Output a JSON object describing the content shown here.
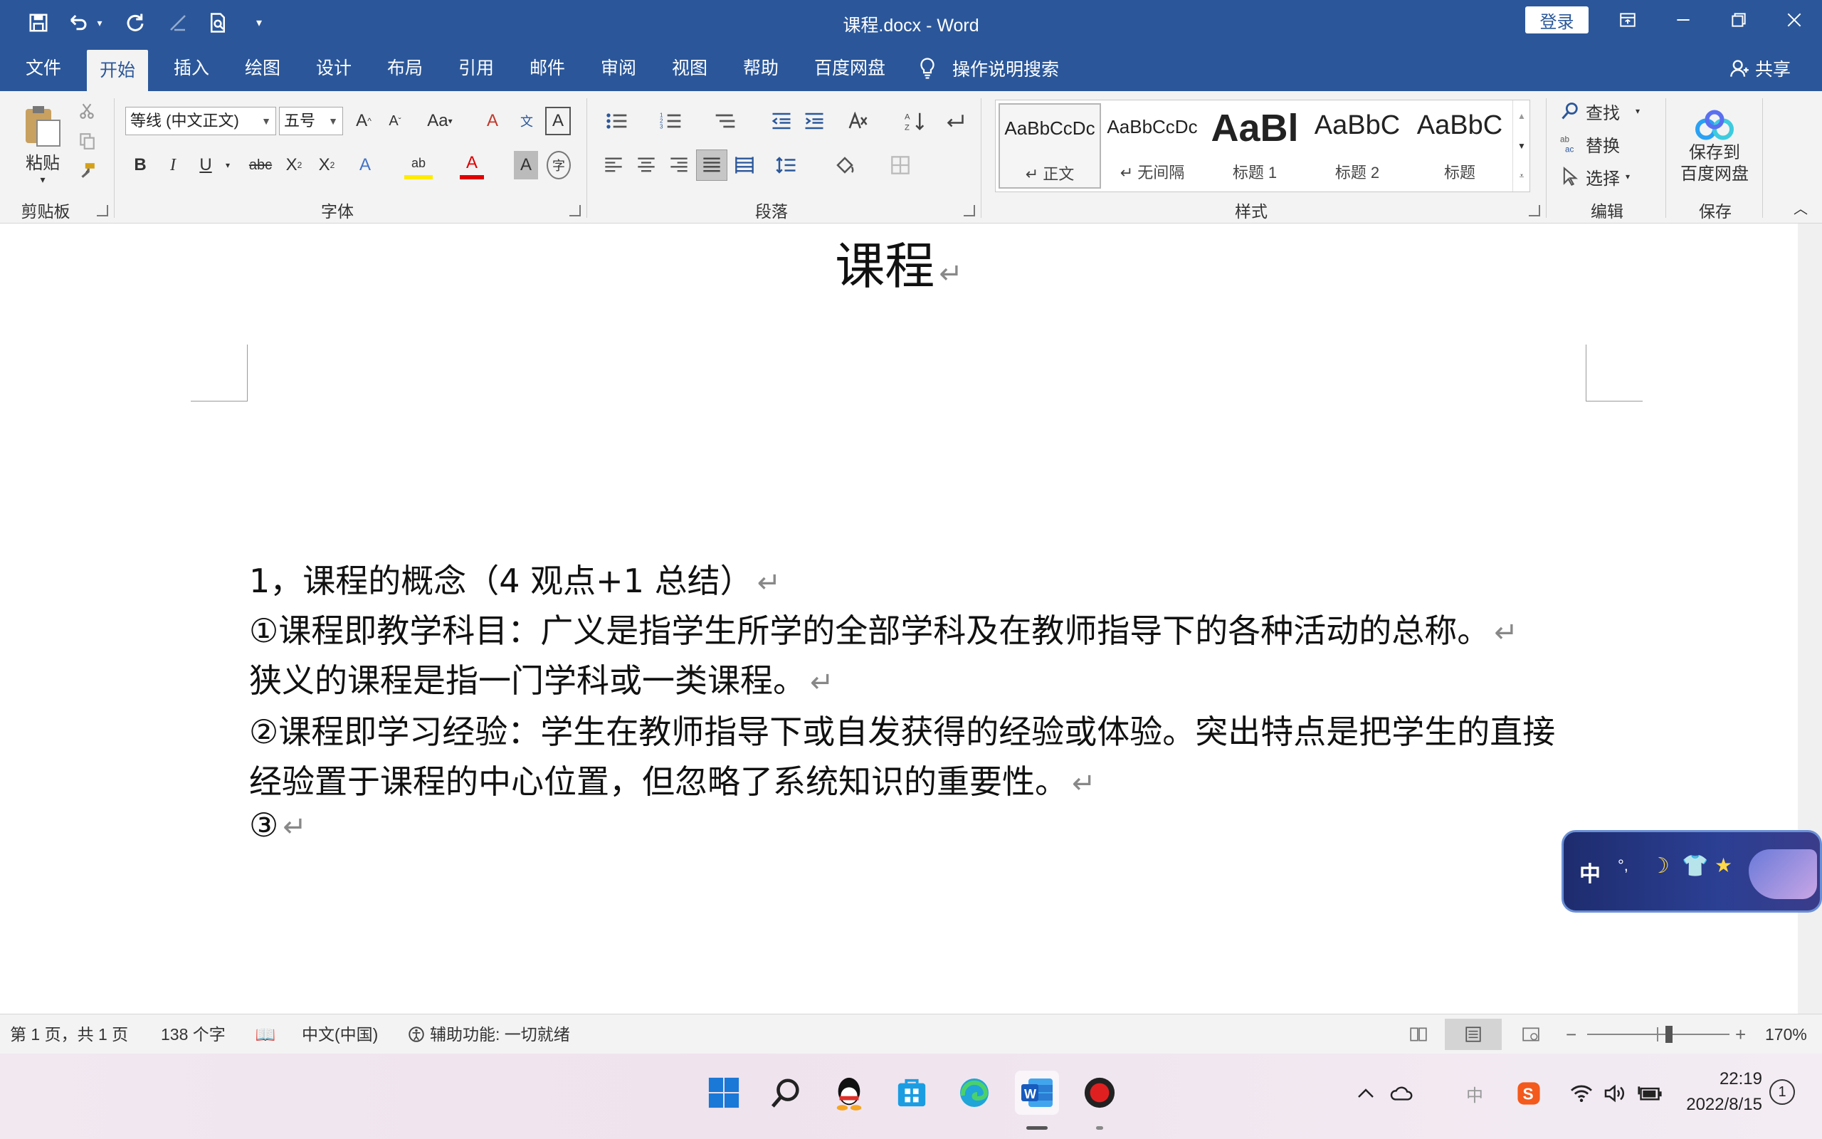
{
  "title_bar": {
    "document_title": "课程.docx  -  Word",
    "login_label": "登录",
    "quick_access_icons": [
      "save-icon",
      "undo-icon",
      "redo-icon",
      "touch-mode-icon",
      "print-preview-icon",
      "customize-icon"
    ]
  },
  "tabs": [
    {
      "label": "文件"
    },
    {
      "label": "开始"
    },
    {
      "label": "插入"
    },
    {
      "label": "绘图"
    },
    {
      "label": "设计"
    },
    {
      "label": "布局"
    },
    {
      "label": "引用"
    },
    {
      "label": "邮件"
    },
    {
      "label": "审阅"
    },
    {
      "label": "视图"
    },
    {
      "label": "帮助"
    },
    {
      "label": "百度网盘"
    }
  ],
  "tell_me": "操作说明搜索",
  "share_label": "共享",
  "ribbon": {
    "clipboard": {
      "paste_label": "粘贴",
      "group_label": "剪贴板"
    },
    "font": {
      "font_name": "等线 (中文正文)",
      "font_size": "五号",
      "group_label": "字体",
      "change_case": "Aa"
    },
    "paragraph": {
      "group_label": "段落"
    },
    "styles": {
      "group_label": "样式",
      "items": [
        {
          "sample": "AaBbCcDc",
          "name": "↵ 正文"
        },
        {
          "sample": "AaBbCcDc",
          "name": "↵ 无间隔"
        },
        {
          "sample": "AaBl",
          "name": "标题 1"
        },
        {
          "sample": "AaBbC",
          "name": "标题 2"
        },
        {
          "sample": "AaBbC",
          "name": "标题"
        }
      ]
    },
    "editing": {
      "find": "查找",
      "replace": "替换",
      "select": "选择",
      "group_label": "编辑"
    },
    "save": {
      "line1": "保存到",
      "line2": "百度网盘",
      "group_label": "保存"
    }
  },
  "document": {
    "heading": "课程",
    "paragraphs": [
      "1，课程的概念（4 观点+1 总结）",
      "①课程即教学科目：广义是指学生所学的全部学科及在教师指导下的各种活动的总称。",
      "狭义的课程是指一门学科或一类课程。",
      "②课程即学习经验：学生在教师指导下或自发获得的经验或体验。突出特点是把学生的直接",
      "经验置于课程的中心位置，但忽略了系统知识的重要性。",
      "③"
    ],
    "paragraph_mark": "↵"
  },
  "ime_widget": {
    "label": "中"
  },
  "status_bar": {
    "page": "第 1 页，共 1 页",
    "words": "138 个字",
    "language": "中文(中国)",
    "accessibility": "辅助功能: 一切就绪",
    "zoom": "170%"
  },
  "taskbar": {
    "apps": [
      "windows-start-icon",
      "search-icon",
      "qq-icon",
      "store-icon",
      "edge-icon",
      "word-icon",
      "recorder-icon"
    ],
    "ime": "中",
    "time": "22:19",
    "date": "2022/8/15",
    "notification_count": "1"
  }
}
